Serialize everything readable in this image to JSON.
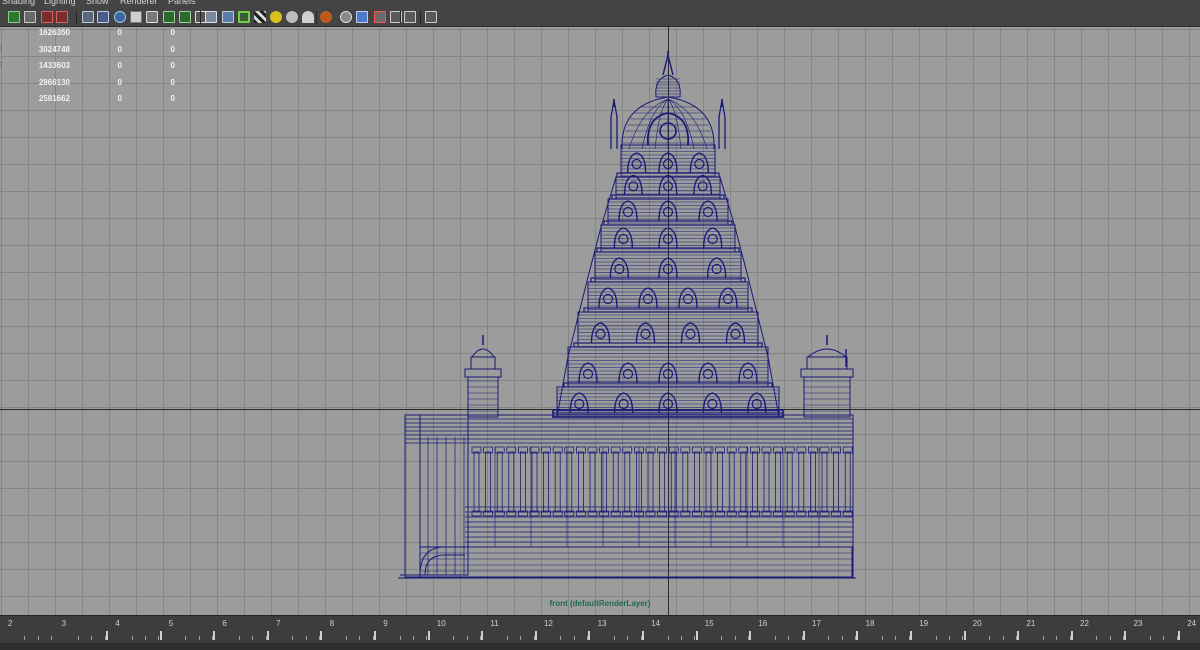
{
  "menu": [
    "Shading",
    "Lighting",
    "Show",
    "Renderer",
    "Panels"
  ],
  "toolbar_icons": [
    "select-camera-icon",
    "camera-attributes-icon",
    "bookmarks-icon",
    "image-plane-icon",
    "two-d-pan-zoom-icon",
    "grid-icon",
    "film-gate-icon",
    "resolution-gate-icon",
    "gate-mask-icon",
    "field-chart-icon",
    "safe-action-icon",
    "safe-title-icon",
    "wireframe-icon",
    "smooth-shade-icon",
    "wireframe-on-shaded-icon",
    "textured-icon",
    "use-all-lights-icon",
    "shadows-icon",
    "screen-space-ao-icon",
    "motion-blur-icon",
    "multisample-aa-icon",
    "depth-of-field-icon",
    "isolate-select-icon",
    "xray-icon",
    "xray-active-components-icon",
    "xray-joints-icon"
  ],
  "hud": {
    "rows": [
      {
        "mark": "",
        "c1": "1626350",
        "c2": "0",
        "c3": "0"
      },
      {
        "mark": ":",
        "c1": "3024748",
        "c2": "0",
        "c3": "0"
      },
      {
        "mark": ":",
        "c1": "1433603",
        "c2": "0",
        "c3": "0"
      },
      {
        "mark": "",
        "c1": "2866130",
        "c2": "0",
        "c3": "0"
      },
      {
        "mark": "",
        "c1": "2581662",
        "c2": "0",
        "c3": "0"
      }
    ]
  },
  "viewport": {
    "camera_label": "front (defaultRenderLayer)",
    "wire_color": "#1a1a78",
    "grid_color": "#858585",
    "axis_color": "#2a2a2a",
    "background_color": "#9c9c9c"
  },
  "timeslider": {
    "labels": [
      "2",
      "3",
      "4",
      "5",
      "6",
      "7",
      "8",
      "9",
      "10",
      "11",
      "12",
      "13",
      "14",
      "15",
      "16",
      "17",
      "18",
      "19",
      "20",
      "21",
      "22",
      "23",
      "24"
    ]
  }
}
